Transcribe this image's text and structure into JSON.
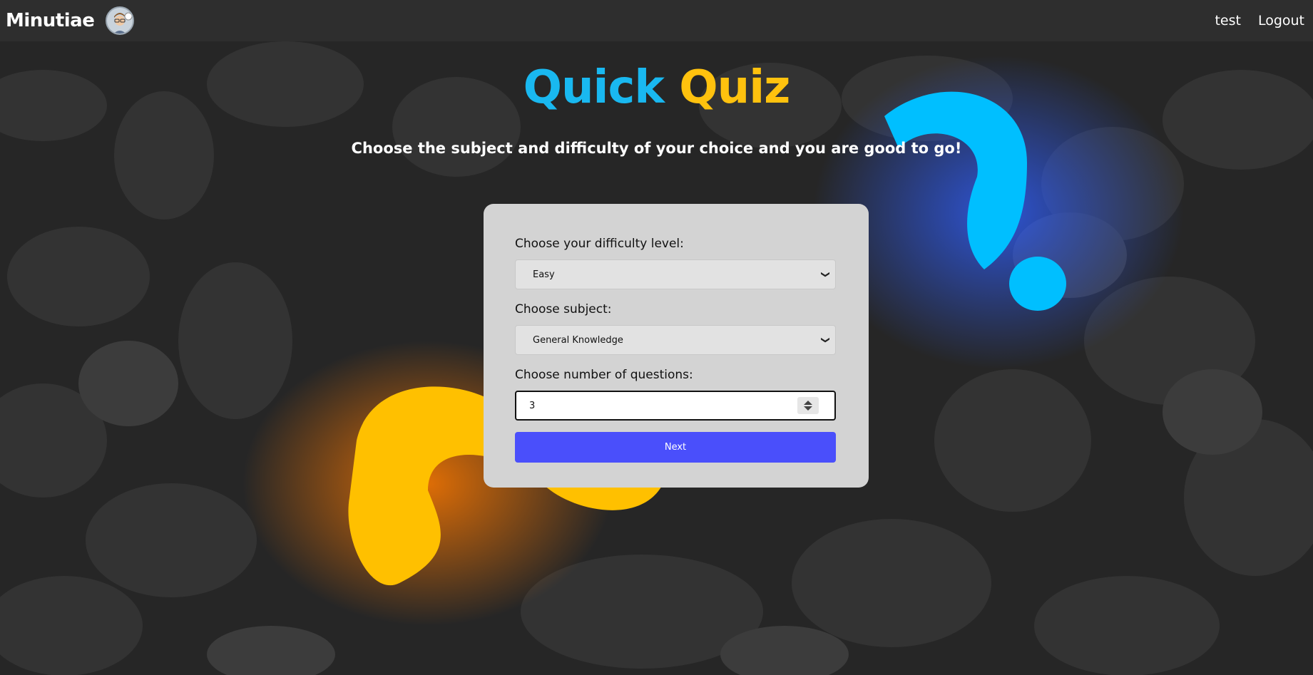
{
  "navbar": {
    "brand": "Minutiae",
    "links": [
      "test",
      "Logout"
    ]
  },
  "hero": {
    "title_part1": "Quick",
    "title_part2": "Quiz",
    "subtitle": "Choose the subject and difficulty of your choice and you are good to go!"
  },
  "form": {
    "difficulty_label": "Choose your difficulty level:",
    "difficulty_value": "Easy",
    "subject_label": "Choose subject:",
    "subject_value": "General Knowledge",
    "count_label": "Choose number of questions:",
    "count_value": "3",
    "next_label": "Next"
  },
  "colors": {
    "title_blue": "#19b8f0",
    "title_yellow": "#ffc20e",
    "button": "#4a4ffb"
  }
}
